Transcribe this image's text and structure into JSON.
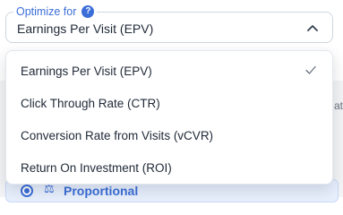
{
  "field": {
    "label": "Optimize for",
    "help_icon": "question-circle-icon",
    "selected_value": "Earnings Per Visit (EPV)"
  },
  "menu": {
    "items": [
      {
        "label": "Earnings Per Visit (EPV)",
        "selected": true
      },
      {
        "label": "Click Through Rate (CTR)",
        "selected": false
      },
      {
        "label": "Conversion Rate from Visits (vCVR)",
        "selected": false
      },
      {
        "label": "Return On Investment (ROI)",
        "selected": false
      }
    ]
  },
  "background": {
    "clipped_text": "at",
    "option_label": "Proportional",
    "option_icon": "balance-scale-icon"
  },
  "colors": {
    "accent": "#3b6ed8",
    "text": "#1f2937",
    "border": "#cfd6e0"
  }
}
